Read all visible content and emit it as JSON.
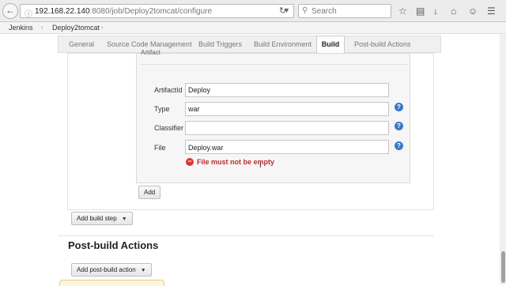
{
  "browser": {
    "url_host": "192.168.22.140",
    "url_path": ":8080/job/Deploy2tomcat/configure",
    "search_placeholder": "Search",
    "icons": [
      "back-icon",
      "info-icon",
      "reload-icon",
      "search-icon",
      "bookmark-star-icon",
      "downloads-icon",
      "home-icon",
      "menu-icon"
    ]
  },
  "breadcrumbs": {
    "root": "Jenkins",
    "job": "Deploy2tomcat"
  },
  "tabs": {
    "general": "General",
    "scm": "Source Code Management",
    "triggers": "Build Triggers",
    "environment": "Build Environment",
    "build": "Build",
    "post_build": "Post-build Actions"
  },
  "artifact": {
    "heading": "Artifact",
    "artifactid_label": "ArtifactId",
    "artifactid_value": "Deploy",
    "type_label": "Type",
    "type_value": "war",
    "classifier_label": "Classifier",
    "classifier_value": "",
    "file_label": "File",
    "file_value": "Deploy.war",
    "error": "File must not be empty"
  },
  "buttons": {
    "add": "Add",
    "add_build_step": "Add build step",
    "add_post_build_action": "Add post-build action"
  },
  "post_build": {
    "heading": "Post-build Actions"
  },
  "colors": {
    "error": "#c12b2b",
    "help": "#3a78c8"
  }
}
